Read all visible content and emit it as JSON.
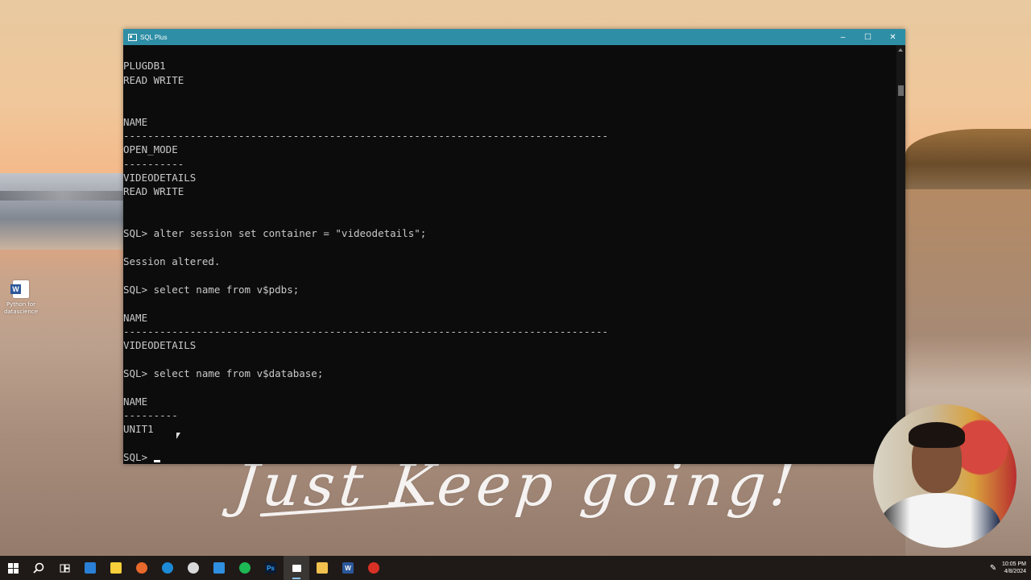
{
  "desktop": {
    "icon_label_line1": "Python for",
    "icon_label_line2": "datascience",
    "handwriting": "Just Keep going!"
  },
  "window": {
    "title": "SQL Plus",
    "controls": {
      "minimize": "–",
      "maximize": "☐",
      "close": "✕"
    }
  },
  "console": {
    "lines": [
      "",
      "PLUGDB1",
      "READ WRITE",
      "",
      "",
      "NAME",
      "--------------------------------------------------------------------------------",
      "OPEN_MODE",
      "----------",
      "VIDEODETAILS",
      "READ WRITE",
      "",
      "",
      "SQL> alter session set container = \"videodetails\";",
      "",
      "Session altered.",
      "",
      "SQL> select name from v$pdbs;",
      "",
      "NAME",
      "--------------------------------------------------------------------------------",
      "VIDEODETAILS",
      "",
      "SQL> select name from v$database;",
      "",
      "NAME",
      "---------",
      "UNIT1",
      "",
      "SQL> "
    ]
  },
  "taskbar": {
    "icons": [
      "windows-start-icon",
      "search-icon",
      "task-view-icon",
      "store-icon",
      "sticky-notes-icon",
      "firefox-icon",
      "edge-icon",
      "bird-app-icon",
      "arrow-app-icon",
      "spotify-icon",
      "photoshop-icon",
      "sqlplus-icon",
      "file-explorer-icon",
      "word-icon",
      "chrome-icon"
    ],
    "photoshop_label": "Ps",
    "word_label": "W",
    "time": "10:05 PM",
    "date": "4/8/2024"
  }
}
